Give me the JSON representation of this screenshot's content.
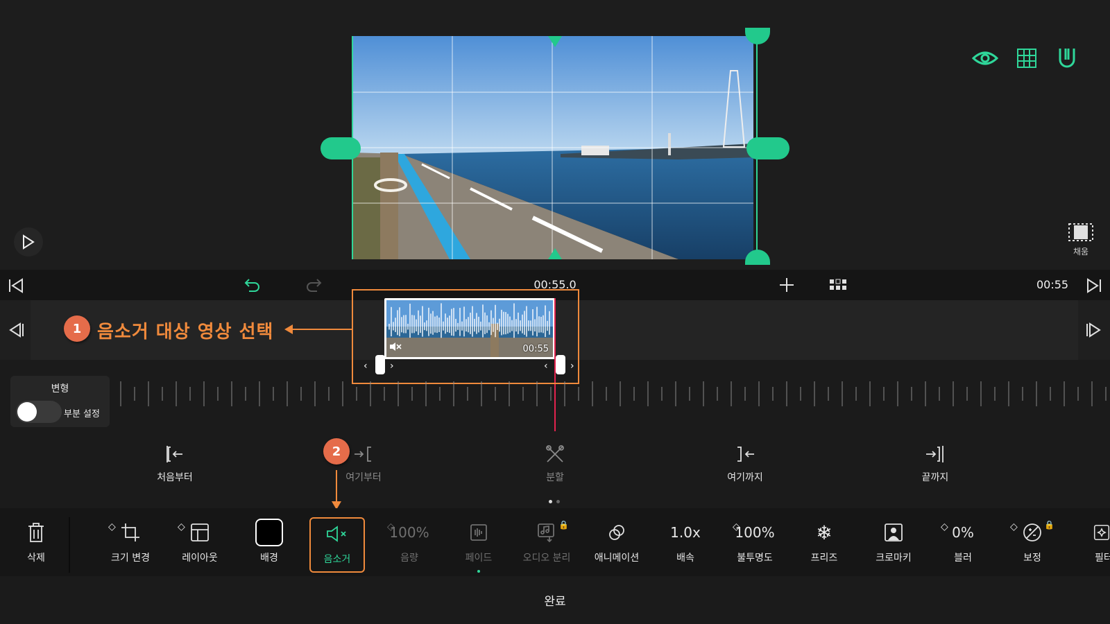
{
  "preview": {
    "fill_label": "채움"
  },
  "timeline": {
    "timecode": "00:55.0",
    "duration": "00:55",
    "clip_duration": "00:55"
  },
  "annotations": {
    "step1_badge": "1",
    "step1_text": "음소거 대상 영상 선택",
    "step2_badge": "2"
  },
  "transform": {
    "title": "변형",
    "toggle_label": "부분 설정",
    "toggle_on": false
  },
  "split_actions": [
    {
      "label": "처음부터",
      "icon": "trim-from-start-icon"
    },
    {
      "label": "여기부터",
      "icon": "trim-from-here-icon"
    },
    {
      "label": "분할",
      "icon": "scissors-icon"
    },
    {
      "label": "여기까지",
      "icon": "trim-to-here-icon"
    },
    {
      "label": "끝까지",
      "icon": "trim-to-end-icon"
    }
  ],
  "tools": {
    "delete": "삭제",
    "resize": "크기 변경",
    "layout": "레이아웃",
    "background": "배경",
    "mute": "음소거",
    "volume_value": "100%",
    "volume": "음량",
    "fade": "페이드",
    "audio_split": "오디오 분리",
    "animation": "애니메이션",
    "speed_value": "1.0x",
    "speed": "배속",
    "opacity_value": "100%",
    "opacity": "불투명도",
    "freeze": "프리즈",
    "chromakey": "크로마키",
    "blur_value": "0%",
    "blur": "블러",
    "correction": "보정",
    "filter": "필터"
  },
  "done_label": "완료",
  "colors": {
    "accent": "#2fd79a",
    "annotation": "#f08a3c",
    "playhead": "#e3234e"
  }
}
